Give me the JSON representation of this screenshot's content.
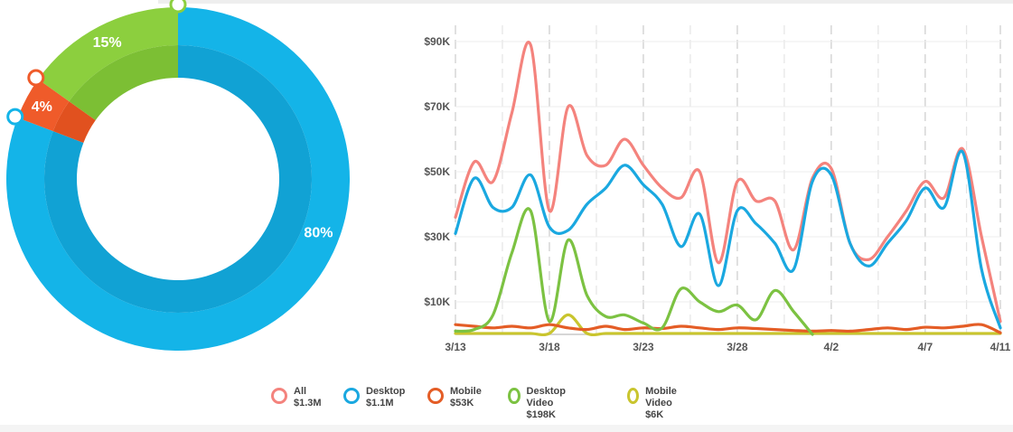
{
  "chart_data": [
    {
      "type": "pie",
      "slices": [
        {
          "label": "80%",
          "value": 80,
          "color": "#14b4e8",
          "inner_color": "#11a2d4"
        },
        {
          "label": "4%",
          "value": 4,
          "color": "#ef5b2a",
          "inner_color": "#e1511f"
        },
        {
          "label": "15%",
          "value": 15,
          "color": "#8ccf3e",
          "inner_color": "#7cbf34"
        }
      ]
    },
    {
      "type": "line",
      "ylim": [
        0,
        95000
      ],
      "xlim": [
        0,
        29
      ],
      "y_ticks": [
        {
          "label": "$10K",
          "value": 10000
        },
        {
          "label": "$30K",
          "value": 30000
        },
        {
          "label": "$50K",
          "value": 50000
        },
        {
          "label": "$70K",
          "value": 70000
        },
        {
          "label": "$90K",
          "value": 90000
        }
      ],
      "x_ticks": [
        {
          "label": "3/13",
          "value": 0
        },
        {
          "label": "3/18",
          "value": 5
        },
        {
          "label": "3/23",
          "value": 10
        },
        {
          "label": "3/28",
          "value": 15
        },
        {
          "label": "4/2",
          "value": 20
        },
        {
          "label": "4/7",
          "value": 25
        },
        {
          "label": "4/11",
          "value": 29
        }
      ],
      "grid": true,
      "series": [
        {
          "name": "All",
          "total": "$1.3M",
          "color": "#f4837d",
          "points": [
            [
              0,
              36000
            ],
            [
              1,
              53000
            ],
            [
              2,
              47000
            ],
            [
              3,
              68000
            ],
            [
              4,
              89000
            ],
            [
              5,
              38000
            ],
            [
              6,
              70000
            ],
            [
              7,
              55000
            ],
            [
              8,
              52000
            ],
            [
              9,
              60000
            ],
            [
              10,
              52000
            ],
            [
              11,
              45000
            ],
            [
              12,
              42000
            ],
            [
              13,
              50000
            ],
            [
              14,
              22000
            ],
            [
              15,
              47000
            ],
            [
              16,
              41000
            ],
            [
              17,
              41000
            ],
            [
              18,
              26000
            ],
            [
              19,
              48000
            ],
            [
              20,
              51000
            ],
            [
              21,
              28000
            ],
            [
              22,
              23000
            ],
            [
              23,
              30000
            ],
            [
              24,
              38000
            ],
            [
              25,
              47000
            ],
            [
              26,
              42000
            ],
            [
              27,
              57000
            ],
            [
              28,
              30000
            ],
            [
              29,
              4000
            ]
          ]
        },
        {
          "name": "Desktop",
          "total": "$1.1M",
          "color": "#1aa8e0",
          "points": [
            [
              0,
              31000
            ],
            [
              1,
              48000
            ],
            [
              2,
              39000
            ],
            [
              3,
              39000
            ],
            [
              4,
              49000
            ],
            [
              5,
              33000
            ],
            [
              6,
              32000
            ],
            [
              7,
              40000
            ],
            [
              8,
              45000
            ],
            [
              9,
              52000
            ],
            [
              10,
              46000
            ],
            [
              11,
              40000
            ],
            [
              12,
              27000
            ],
            [
              13,
              37000
            ],
            [
              14,
              15000
            ],
            [
              15,
              38000
            ],
            [
              16,
              34000
            ],
            [
              17,
              28000
            ],
            [
              18,
              20000
            ],
            [
              19,
              47000
            ],
            [
              20,
              49000
            ],
            [
              21,
              28000
            ],
            [
              22,
              21000
            ],
            [
              23,
              28000
            ],
            [
              24,
              35000
            ],
            [
              25,
              45000
            ],
            [
              26,
              39000
            ],
            [
              27,
              56000
            ],
            [
              28,
              20000
            ],
            [
              29,
              2000
            ]
          ]
        },
        {
          "name": "Mobile",
          "total": "$53K",
          "color": "#e45d26",
          "points": [
            [
              0,
              3000
            ],
            [
              1,
              2500
            ],
            [
              2,
              2000
            ],
            [
              3,
              2500
            ],
            [
              4,
              2000
            ],
            [
              5,
              3000
            ],
            [
              6,
              2000
            ],
            [
              7,
              1500
            ],
            [
              8,
              2500
            ],
            [
              9,
              1500
            ],
            [
              10,
              2000
            ],
            [
              11,
              1800
            ],
            [
              12,
              2500
            ],
            [
              13,
              2000
            ],
            [
              14,
              1500
            ],
            [
              15,
              2000
            ],
            [
              16,
              1800
            ],
            [
              17,
              1500
            ],
            [
              18,
              1200
            ],
            [
              19,
              1000
            ],
            [
              20,
              1200
            ],
            [
              21,
              1000
            ],
            [
              22,
              1500
            ],
            [
              23,
              2000
            ],
            [
              24,
              1500
            ],
            [
              25,
              2200
            ],
            [
              26,
              2000
            ],
            [
              27,
              2500
            ],
            [
              28,
              3000
            ],
            [
              29,
              500
            ]
          ]
        },
        {
          "name": "Desktop Video",
          "total": "$198K",
          "color": "#7cc242",
          "points": [
            [
              0,
              1000
            ],
            [
              1,
              1500
            ],
            [
              2,
              6000
            ],
            [
              3,
              25000
            ],
            [
              4,
              38000
            ],
            [
              5,
              4000
            ],
            [
              6,
              29000
            ],
            [
              7,
              12000
            ],
            [
              8,
              5500
            ],
            [
              9,
              6000
            ],
            [
              10,
              3500
            ],
            [
              11,
              2000
            ],
            [
              12,
              14000
            ],
            [
              13,
              10000
            ],
            [
              14,
              7000
            ],
            [
              15,
              9000
            ],
            [
              16,
              4500
            ],
            [
              17,
              13500
            ],
            [
              18,
              7000
            ],
            [
              19,
              0
            ]
          ]
        },
        {
          "name": "Mobile Video",
          "total": "$6K",
          "color": "#c9c52e",
          "points": [
            [
              0,
              300
            ],
            [
              1,
              300
            ],
            [
              2,
              300
            ],
            [
              3,
              300
            ],
            [
              4,
              300
            ],
            [
              5,
              300
            ],
            [
              6,
              6000
            ],
            [
              7,
              300
            ],
            [
              8,
              300
            ],
            [
              9,
              300
            ],
            [
              10,
              300
            ],
            [
              11,
              300
            ],
            [
              12,
              300
            ],
            [
              13,
              300
            ],
            [
              14,
              300
            ],
            [
              15,
              300
            ],
            [
              16,
              300
            ],
            [
              17,
              300
            ],
            [
              18,
              300
            ],
            [
              19,
              300
            ],
            [
              20,
              300
            ],
            [
              21,
              300
            ],
            [
              22,
              300
            ],
            [
              23,
              300
            ],
            [
              24,
              300
            ],
            [
              25,
              300
            ],
            [
              26,
              300
            ],
            [
              27,
              300
            ],
            [
              28,
              300
            ],
            [
              29,
              300
            ]
          ]
        }
      ]
    }
  ]
}
